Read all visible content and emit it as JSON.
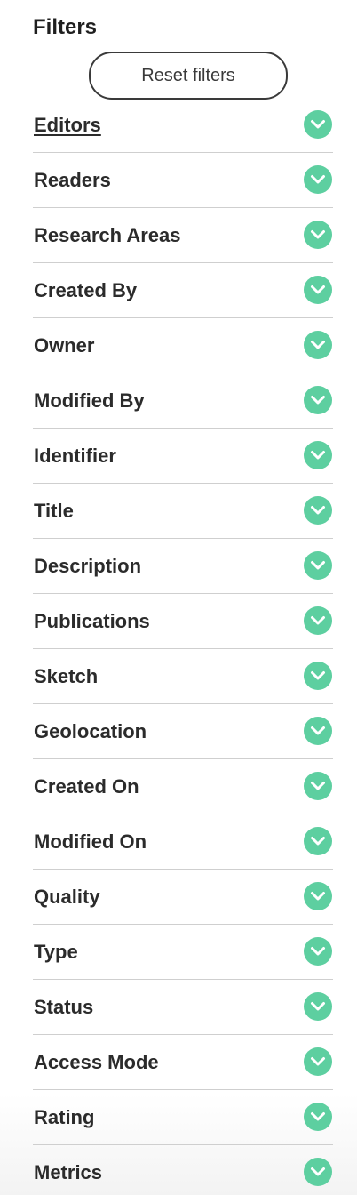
{
  "panel": {
    "title": "Filters",
    "reset_label": "Reset filters",
    "accent_color": "#5dcfa0",
    "filters": [
      {
        "label": "Editors",
        "active": true,
        "icon": "chevron-down-icon"
      },
      {
        "label": "Readers",
        "active": false,
        "icon": "chevron-down-icon"
      },
      {
        "label": "Research Areas",
        "active": false,
        "icon": "chevron-down-icon"
      },
      {
        "label": "Created By",
        "active": false,
        "icon": "chevron-down-icon"
      },
      {
        "label": "Owner",
        "active": false,
        "icon": "chevron-down-icon"
      },
      {
        "label": "Modified By",
        "active": false,
        "icon": "chevron-down-icon"
      },
      {
        "label": "Identifier",
        "active": false,
        "icon": "chevron-down-icon"
      },
      {
        "label": "Title",
        "active": false,
        "icon": "chevron-down-icon"
      },
      {
        "label": "Description",
        "active": false,
        "icon": "chevron-down-icon"
      },
      {
        "label": "Publications",
        "active": false,
        "icon": "chevron-down-icon"
      },
      {
        "label": "Sketch",
        "active": false,
        "icon": "chevron-down-icon"
      },
      {
        "label": "Geolocation",
        "active": false,
        "icon": "chevron-down-icon"
      },
      {
        "label": "Created On",
        "active": false,
        "icon": "chevron-down-icon"
      },
      {
        "label": "Modified On",
        "active": false,
        "icon": "chevron-down-icon"
      },
      {
        "label": "Quality",
        "active": false,
        "icon": "chevron-down-icon"
      },
      {
        "label": "Type",
        "active": false,
        "icon": "chevron-down-icon"
      },
      {
        "label": "Status",
        "active": false,
        "icon": "chevron-down-icon"
      },
      {
        "label": "Access Mode",
        "active": false,
        "icon": "chevron-down-icon"
      },
      {
        "label": "Rating",
        "active": false,
        "icon": "chevron-down-icon"
      },
      {
        "label": "Metrics",
        "active": false,
        "icon": "chevron-down-icon"
      }
    ]
  }
}
